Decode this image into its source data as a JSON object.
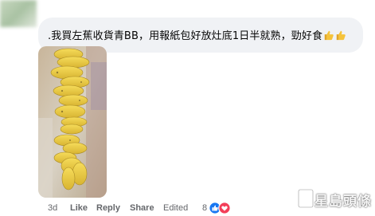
{
  "comment": {
    "text": ".我買左蕉收貨青BB，用報紙包好放灶底1日半就熟，勁好食",
    "emoji_icon": "thumbs-up-emoji"
  },
  "footer": {
    "time": "3d",
    "like_label": "Like",
    "reply_label": "Reply",
    "share_label": "Share",
    "edited_label": "Edited",
    "reaction_count": "8",
    "reactions": [
      "like-reaction-icon",
      "love-reaction-icon"
    ]
  },
  "watermark": {
    "text": "星島頭條"
  },
  "colors": {
    "bubble": "#f0f2f5",
    "meta_text": "#65676b",
    "like_blue": "#1877f2",
    "love_red": "#f33e58"
  }
}
